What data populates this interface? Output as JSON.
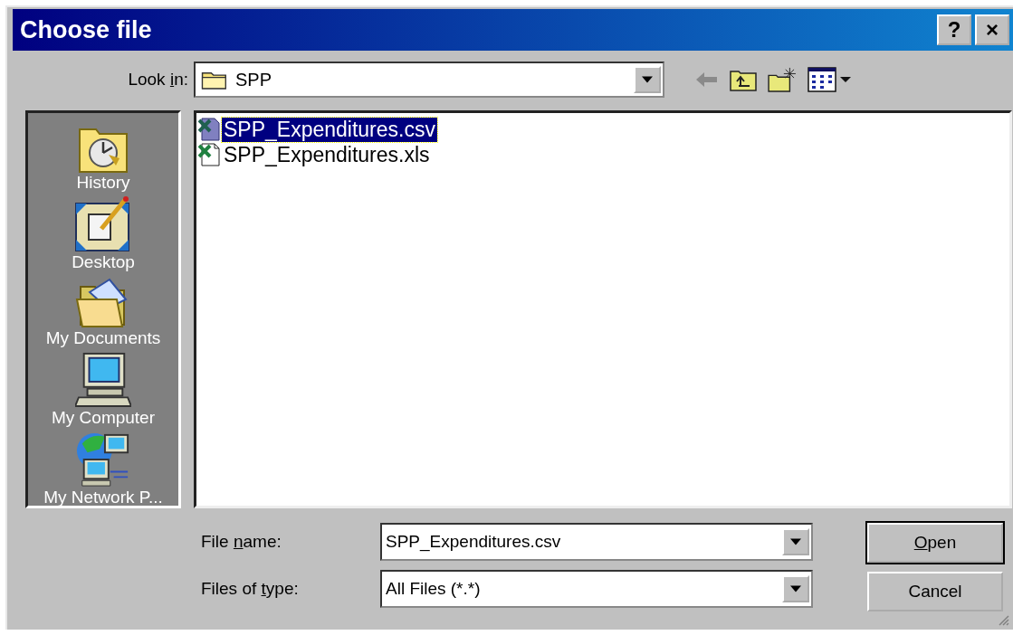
{
  "window": {
    "title": "Choose file",
    "title_buttons": [
      "?",
      "×"
    ]
  },
  "look_in": {
    "label": [
      {
        "text": "Look ",
        "underlined": false
      },
      {
        "text": "i",
        "underlined": true
      },
      {
        "text": "n:",
        "underlined": false
      }
    ],
    "value": "SPP"
  },
  "places": [
    {
      "label": "History",
      "kind": "history",
      "selected": false
    },
    {
      "label": "Desktop",
      "kind": "desktop",
      "selected": false
    },
    {
      "label": "My Documents",
      "kind": "documents",
      "selected": false
    },
    {
      "label": "My Computer",
      "kind": "computer",
      "selected": false
    },
    {
      "label": "My Network P...",
      "kind": "network",
      "selected": false
    }
  ],
  "files": [
    {
      "name": "SPP_Expenditures.csv",
      "kind": "csv",
      "selected": true
    },
    {
      "name": "SPP_Expenditures.xls",
      "kind": "xls",
      "selected": false
    }
  ],
  "file_name": {
    "label": [
      {
        "text": "File ",
        "underlined": false
      },
      {
        "text": "n",
        "underlined": true
      },
      {
        "text": "ame:",
        "underlined": false
      }
    ],
    "value": "SPP_Expenditures.csv"
  },
  "file_type": {
    "label": [
      {
        "text": "Files of ",
        "underlined": false
      },
      {
        "text": "t",
        "underlined": true
      },
      {
        "text": "ype:",
        "underlined": false
      }
    ],
    "value": "All Files (*.*)"
  },
  "buttons": [
    {
      "label": [
        {
          "text": "O",
          "underlined": true
        },
        {
          "text": "pen",
          "underlined": false
        }
      ],
      "default": true
    },
    {
      "label": [
        {
          "text": "Cancel",
          "underlined": false
        }
      ],
      "default": false
    }
  ]
}
